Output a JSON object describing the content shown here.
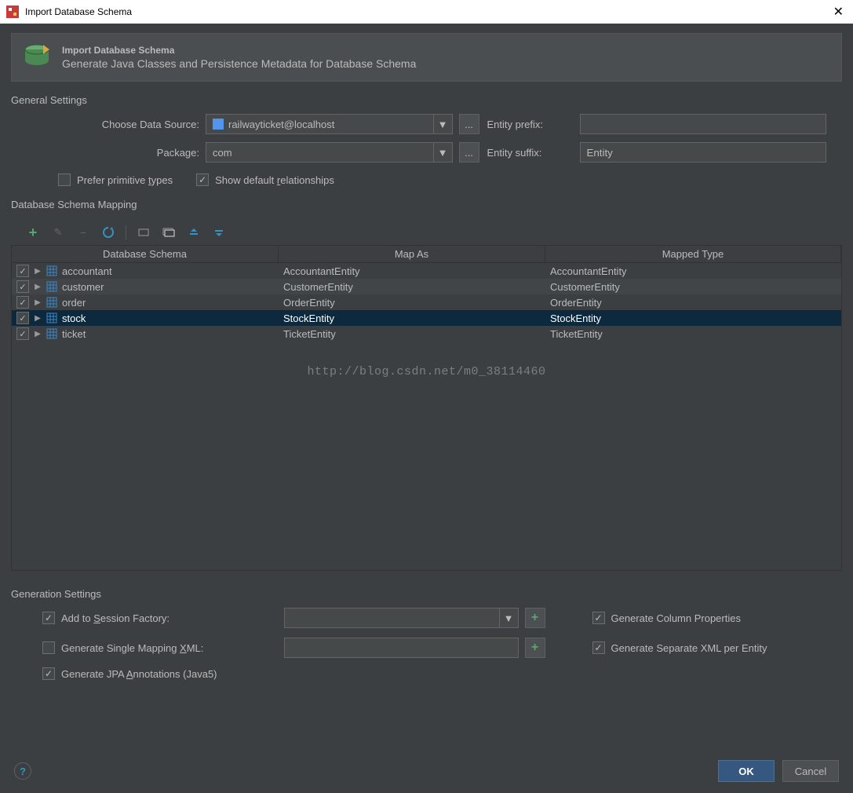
{
  "window": {
    "title": "Import Database Schema"
  },
  "banner": {
    "title": "Import Database Schema",
    "subtitle": "Generate Java Classes and Persistence Metadata for Database Schema"
  },
  "sections": {
    "general": "General Settings",
    "mapping": "Database Schema Mapping",
    "generation": "Generation Settings"
  },
  "general": {
    "dataSourceLabel": "Choose Data Source:",
    "dataSourceValue": "railwayticket@localhost",
    "packageLabel": "Package:",
    "packageValue": "com",
    "entityPrefixLabel": "Entity prefix:",
    "entityPrefixValue": "",
    "entitySuffixLabel": "Entity suffix:",
    "entitySuffixValue": "Entity",
    "preferPrimitiveLabel": "Prefer primitive types",
    "showDefaultRelLabel": "Show default relationships",
    "ellipsis": "..."
  },
  "table": {
    "headers": {
      "schema": "Database Schema",
      "mapAs": "Map As",
      "mappedType": "Mapped Type"
    },
    "rows": [
      {
        "schema": "accountant",
        "mapAs": "AccountantEntity",
        "mappedType": "AccountantEntity",
        "selected": false
      },
      {
        "schema": "customer",
        "mapAs": "CustomerEntity",
        "mappedType": "CustomerEntity",
        "selected": false
      },
      {
        "schema": "order",
        "mapAs": "OrderEntity",
        "mappedType": "OrderEntity",
        "selected": false
      },
      {
        "schema": "stock",
        "mapAs": "StockEntity",
        "mappedType": "StockEntity",
        "selected": true
      },
      {
        "schema": "ticket",
        "mapAs": "TicketEntity",
        "mappedType": "TicketEntity",
        "selected": false
      }
    ]
  },
  "watermark": "http://blog.csdn.net/m0_38114460",
  "generation": {
    "addSessionFactory": "Add to Session Factory:",
    "generateSingleXml": "Generate Single Mapping XML:",
    "generateJpa": "Generate JPA Annotations (Java5)",
    "generateColumnProps": "Generate Column Properties",
    "generateSeparateXml": "Generate Separate XML per Entity",
    "sessionFactoryValue": "",
    "singleXmlValue": ""
  },
  "buttons": {
    "ok": "OK",
    "cancel": "Cancel",
    "help": "?",
    "plus": "+"
  }
}
